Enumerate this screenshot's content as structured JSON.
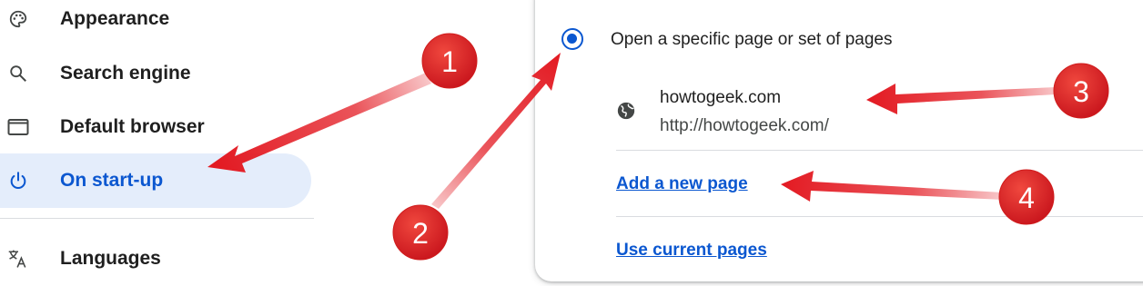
{
  "sidebar": {
    "items": [
      {
        "label": "Appearance",
        "icon": "palette-icon"
      },
      {
        "label": "Search engine",
        "icon": "search-icon"
      },
      {
        "label": "Default browser",
        "icon": "browser-window-icon"
      },
      {
        "label": "On start-up",
        "icon": "power-icon",
        "active": true
      },
      {
        "label": "Languages",
        "icon": "translate-icon"
      }
    ]
  },
  "startup": {
    "option_label": "Open a specific page or set of pages",
    "option_selected": true,
    "page": {
      "name": "howtogeek.com",
      "url": "http://howtogeek.com/"
    },
    "add_page_link": "Add a new page",
    "use_current_link": "Use current pages"
  },
  "annotations": {
    "badges": [
      "1",
      "2",
      "3",
      "4"
    ],
    "badge_color": "#e02020"
  },
  "colors": {
    "accent": "#0b57d0",
    "active_bg": "#e4edfb",
    "arrow": "#e31b23"
  }
}
